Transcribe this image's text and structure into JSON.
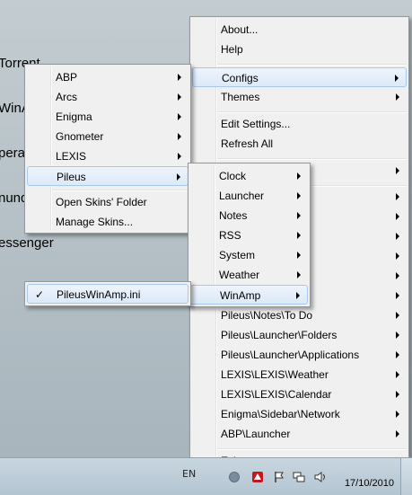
{
  "desktop": {
    "labels": [
      "Torrent",
      "WinA",
      "pera",
      "nund",
      "essenger"
    ]
  },
  "main_menu": {
    "items": [
      {
        "label": "About...",
        "arrow": false
      },
      {
        "label": "Help",
        "arrow": false
      },
      {
        "label": "Configs",
        "arrow": true,
        "highlighted": true
      },
      {
        "label": "Themes",
        "arrow": true
      },
      {
        "label": "Edit Settings...",
        "arrow": false
      },
      {
        "label": "Refresh All",
        "arrow": false
      },
      {
        "label": "",
        "arrow": true
      },
      {
        "label": "",
        "arrow": true
      },
      {
        "label": "",
        "arrow": true
      },
      {
        "label": "",
        "arrow": true
      },
      {
        "label": "",
        "arrow": true
      },
      {
        "label": "",
        "arrow": true
      },
      {
        "label": "",
        "arrow": true
      },
      {
        "label": "Pileus\\Notes\\To Do",
        "arrow": true
      },
      {
        "label": "Pileus\\Launcher\\Folders",
        "arrow": true
      },
      {
        "label": "Pileus\\Launcher\\Applications",
        "arrow": true
      },
      {
        "label": "LEXIS\\LEXIS\\Weather",
        "arrow": true
      },
      {
        "label": "LEXIS\\LEXIS\\Calendar",
        "arrow": true
      },
      {
        "label": "Enigma\\Sidebar\\Network",
        "arrow": true
      },
      {
        "label": "ABP\\Launcher",
        "arrow": true
      },
      {
        "label": "Exit",
        "arrow": false
      }
    ]
  },
  "configs_menu": {
    "items": [
      {
        "label": "ABP"
      },
      {
        "label": "Arcs"
      },
      {
        "label": "Enigma"
      },
      {
        "label": "Gnometer"
      },
      {
        "label": "LEXIS"
      },
      {
        "label": "Pileus",
        "highlighted": true
      },
      {
        "label": "Open Skins' Folder"
      },
      {
        "label": "Manage Skins..."
      }
    ]
  },
  "pileus_menu": {
    "items": [
      {
        "label": "Clock"
      },
      {
        "label": "Launcher"
      },
      {
        "label": "Notes"
      },
      {
        "label": "RSS"
      },
      {
        "label": "System"
      },
      {
        "label": "Weather"
      },
      {
        "label": "WinAmp",
        "highlighted": true
      }
    ]
  },
  "winamp_menu": {
    "items": [
      {
        "label": "PileusWinAmp.ini",
        "checked": true,
        "check_glyph": "✓"
      }
    ]
  },
  "taskbar": {
    "language": "EN",
    "date": "17/10/2010"
  }
}
